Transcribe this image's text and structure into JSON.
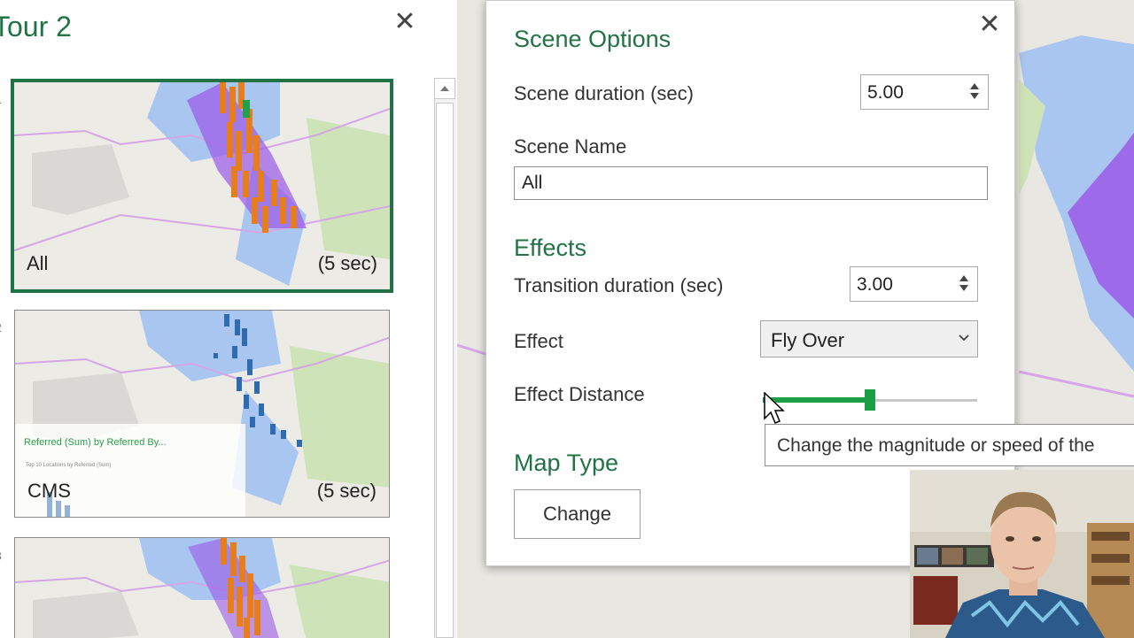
{
  "tour_pane": {
    "title": "Tour 2",
    "close_glyph": "✕",
    "scenes": [
      {
        "label": "All",
        "duration": "(5 sec)",
        "selected": true,
        "row": "1"
      },
      {
        "label": "CMS",
        "duration": "(5 sec)",
        "selected": false,
        "row": "2",
        "overlay_title": "Referred (Sum) by Referred By...",
        "overlay_subtitle": "Top 10 Locations  by Referred (Sum)"
      },
      {
        "label": "",
        "duration": "",
        "selected": false,
        "row": "3"
      }
    ]
  },
  "dialog": {
    "close_glyph": "✕",
    "heading": "Scene Options",
    "scene_duration_label": "Scene duration (sec)",
    "scene_duration_value": "5.00",
    "scene_name_label": "Scene Name",
    "scene_name_value": "All",
    "effects_heading": "Effects",
    "transition_duration_label": "Transition duration (sec)",
    "transition_duration_value": "3.00",
    "effect_label": "Effect",
    "effect_value": "Fly Over",
    "effect_distance_label": "Effect Distance",
    "effect_distance_level": 0.5,
    "map_type_heading": "Map Type",
    "change_button": "Change"
  },
  "tooltip": {
    "text": "Change the magnitude or speed of the"
  },
  "colors": {
    "accent": "#217346",
    "slider": "#1c9e47",
    "water": "#a9c6f0",
    "park": "#cfe3b8",
    "bars_orange": "#e87e1a",
    "bars_blue": "#2e6bb0",
    "region_purple": "#9b59e8"
  },
  "icons": {
    "close": "close-icon",
    "spin_up": "caret-up-icon",
    "spin_down": "caret-down-icon",
    "dropdown": "chevron-down-icon",
    "cursor": "mouse-pointer-icon"
  }
}
